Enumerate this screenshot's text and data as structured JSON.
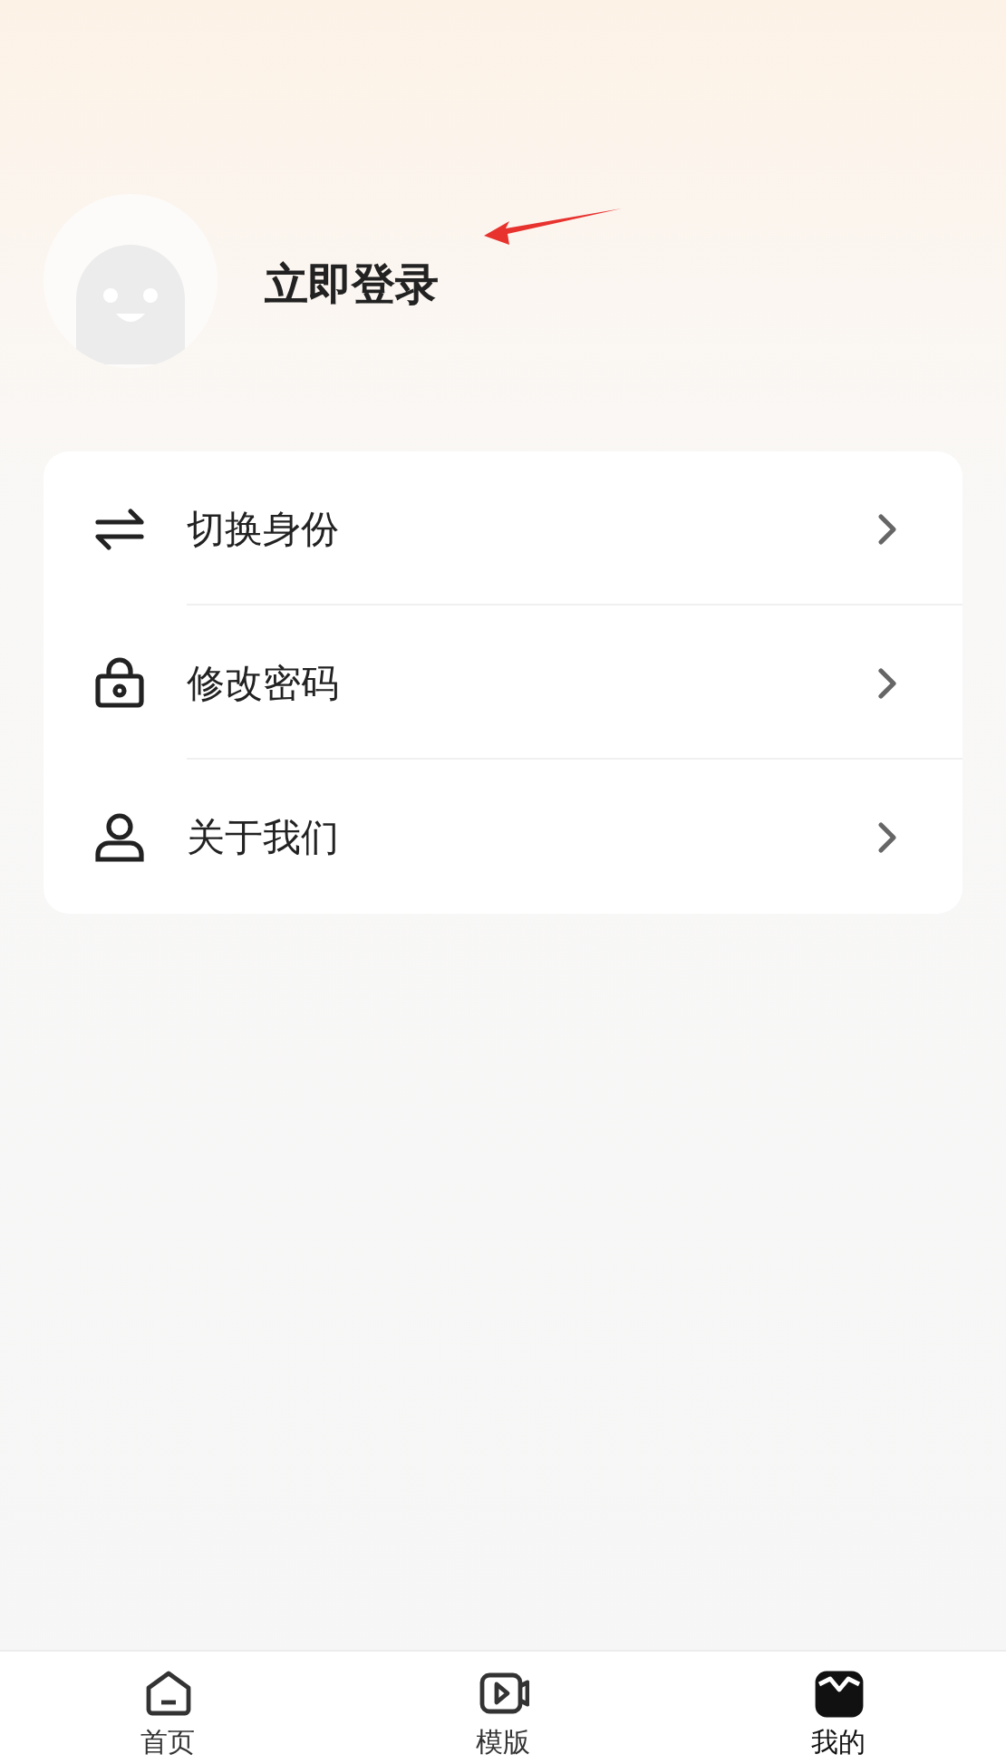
{
  "profile": {
    "login_label": "立即登录"
  },
  "menu": [
    {
      "kind": "switch",
      "label": "切换身份"
    },
    {
      "kind": "lock",
      "label": "修改密码"
    },
    {
      "kind": "user",
      "label": "关于我们"
    }
  ],
  "tab_bar": [
    {
      "kind": "home",
      "label": "首页",
      "selected": false
    },
    {
      "kind": "video",
      "label": "模版",
      "selected": false
    },
    {
      "kind": "mine",
      "label": "我的",
      "selected": true
    }
  ]
}
